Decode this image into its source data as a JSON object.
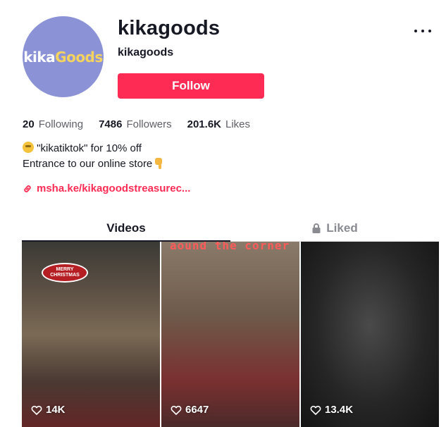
{
  "profile": {
    "logo_part1": "kika",
    "logo_part2": "Goods",
    "username": "kikagoods",
    "nickname": "kikagoods",
    "follow_label": "Follow"
  },
  "stats": {
    "following_count": "20",
    "following_label": "Following",
    "followers_count": "7486",
    "followers_label": "Followers",
    "likes_count": "201.6K",
    "likes_label": "Likes"
  },
  "bio": {
    "line1": "\"kikatiktok\" for 10% off",
    "line2": "Entrance to our online store",
    "link": "msha.ke/kikagoodstreasurec..."
  },
  "tabs": {
    "videos": "Videos",
    "liked": "Liked"
  },
  "videos": [
    {
      "views": "14K",
      "sign_text": "MERRY CHRISTMAS"
    },
    {
      "views": "6647",
      "overlay_text": "aound the corner"
    },
    {
      "views": "13.4K"
    }
  ],
  "colors": {
    "accent": "#fe2c55",
    "avatar_bg": "#8b93d6",
    "text_primary": "#161823",
    "text_secondary": "#8a8b91"
  },
  "icons": {
    "more": "more-horizontal-icon",
    "link": "link-icon",
    "lock": "lock-icon",
    "heart": "heart-outline-icon"
  }
}
